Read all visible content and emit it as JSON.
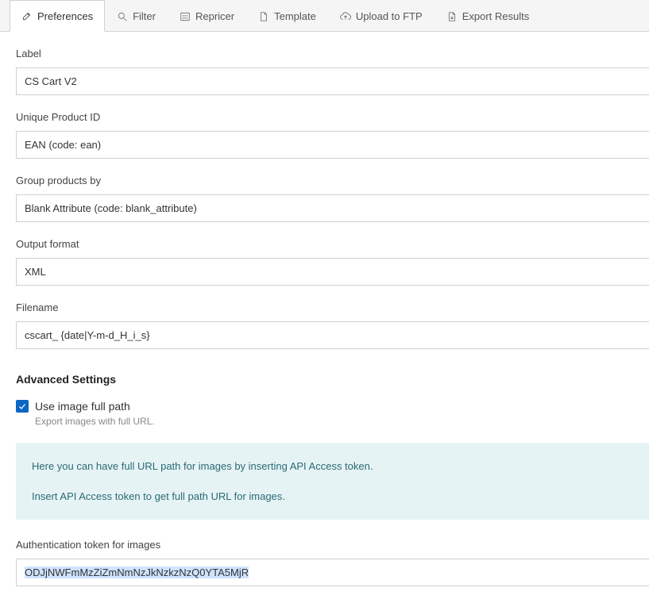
{
  "tabs": [
    {
      "id": "preferences",
      "label": "Preferences"
    },
    {
      "id": "filter",
      "label": "Filter"
    },
    {
      "id": "repricer",
      "label": "Repricer"
    },
    {
      "id": "template",
      "label": "Template"
    },
    {
      "id": "upload",
      "label": "Upload to FTP"
    },
    {
      "id": "export",
      "label": "Export Results"
    }
  ],
  "fields": {
    "label": {
      "label": "Label",
      "value": "CS Cart V2"
    },
    "unique_product_id": {
      "label": "Unique Product ID",
      "value": "EAN (code: ean)"
    },
    "group_by": {
      "label": "Group products by",
      "value": "Blank Attribute (code: blank_attribute)"
    },
    "output_format": {
      "label": "Output format",
      "value": "XML"
    },
    "filename": {
      "label": "Filename",
      "value": "cscart_ {date|Y-m-d_H_i_s}"
    }
  },
  "advanced": {
    "heading": "Advanced Settings",
    "use_full_path": {
      "label": "Use image full path",
      "help": "Export images with full URL.",
      "checked": true
    },
    "info_line1": "Here you can have full URL path for images by inserting API Access token.",
    "info_line2": "Insert API Access token to get full path URL for images.",
    "token": {
      "label": "Authentication token for images",
      "value": "ODJjNWFmMzZiZmNmNzJkNzkzNzQ0YTA5MjR"
    }
  }
}
